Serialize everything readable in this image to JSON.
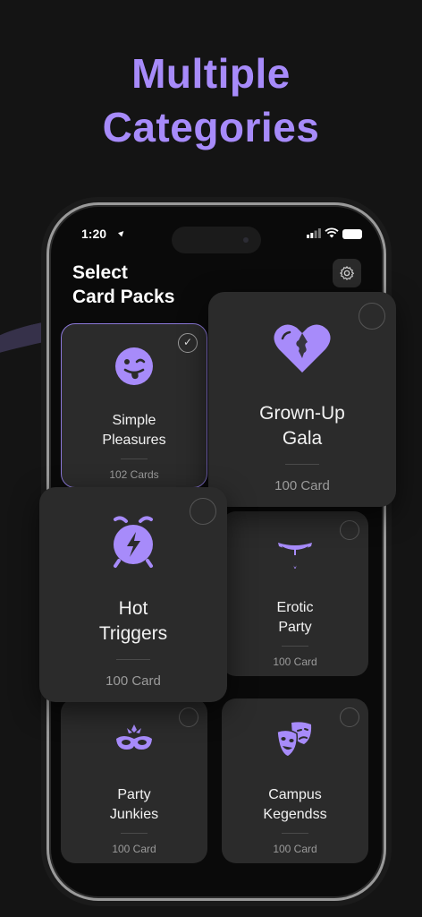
{
  "headline": {
    "line1": "Multiple",
    "line2": "Categories"
  },
  "status_bar": {
    "time": "1:20"
  },
  "screen": {
    "title_line1": "Select",
    "title_line2": "Card Packs"
  },
  "icons": {
    "settings": "gear-icon",
    "location": "location-arrow-icon",
    "signal": "signal-icon",
    "wifi": "wifi-icon",
    "battery": "battery-icon"
  },
  "accent_color": "#a78bfa",
  "packs": [
    {
      "name_line1": "Simple",
      "name_line2": "Pleasures",
      "count": "102 Cards",
      "icon": "winking-tongue-face-icon",
      "selected": true
    },
    {
      "name_line1": "Grown-Up",
      "name_line2": "Gala",
      "count": "100 Card",
      "icon": "puzzle-heart-icon",
      "selected": false
    },
    {
      "name_line1": "Hot",
      "name_line2": "Triggers",
      "count": "100 Card",
      "icon": "alarm-clock-icon",
      "selected": false
    },
    {
      "name_line1": "Erotic",
      "name_line2": "Party",
      "count": "100 Card",
      "icon": "thong-icon",
      "selected": false
    },
    {
      "name_line1": "Party",
      "name_line2": "Junkies",
      "count": "100 Card",
      "icon": "carnival-mask-icon",
      "selected": false
    },
    {
      "name_line1": "Campus",
      "name_line2": "Kegendss",
      "count": "100 Card",
      "icon": "theater-masks-icon",
      "selected": false
    }
  ]
}
